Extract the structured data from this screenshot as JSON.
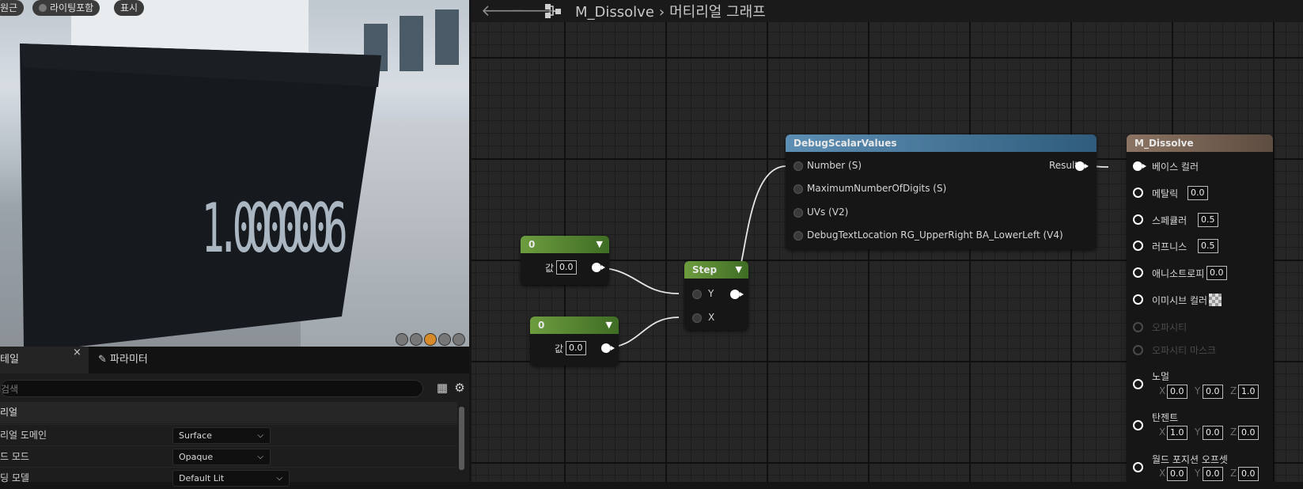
{
  "viewport": {
    "pills": [
      "원근",
      "라이팅포함",
      "표시"
    ],
    "preview_value": "1.0000006"
  },
  "details": {
    "tab_details": "테일",
    "tab_close": "×",
    "tab_params": "파라미터",
    "search_placeholder": "검색",
    "section": "리얼",
    "rows": [
      {
        "label": "리얼 도메인",
        "value": "Surface"
      },
      {
        "label": "드 모드",
        "value": "Opaque"
      },
      {
        "label": "딩 모델",
        "value": "Default Lit"
      }
    ]
  },
  "graph": {
    "breadcrumb": {
      "material": "M_Dissolve",
      "graph": "머티리얼 그래프"
    },
    "const1": {
      "title": "0",
      "value_label": "값",
      "value": "0.0"
    },
    "const2": {
      "title": "0",
      "value_label": "값",
      "value": "0.0"
    },
    "step": {
      "title": "Step",
      "y": "Y",
      "x": "X"
    },
    "debug": {
      "title": "DebugScalarValues",
      "inputs": [
        "Number (S)",
        "MaximumNumberOfDigits (S)",
        "UVs (V2)",
        "DebugTextLocation RG_UpperRight BA_LowerLeft (V4)"
      ],
      "output": "Result"
    },
    "result": {
      "title": "M_Dissolve",
      "base_color": "베이스 컬러",
      "metallic": "메탈릭",
      "metallic_val": "0.0",
      "specular": "스페큘러",
      "specular_val": "0.5",
      "roughness": "러프니스",
      "roughness_val": "0.5",
      "anisotropy": "애니소트로피",
      "anisotropy_val": "0.0",
      "emissive": "이미시브 컬러",
      "opacity": "오파시티",
      "opacity_mask": "오파시티 마스크",
      "normal": "노멀",
      "normal_x": "0.0",
      "normal_y": "0.0",
      "normal_z": "1.0",
      "tangent": "탄젠트",
      "tangent_x": "1.0",
      "tangent_y": "0.0",
      "tangent_z": "0.0",
      "wpo": "월드 포지션 오프셋",
      "wpo_x": "0.0",
      "wpo_y": "0.0",
      "wpo_z": "0.0",
      "x": "X",
      "y": "Y",
      "z": "Z"
    }
  }
}
